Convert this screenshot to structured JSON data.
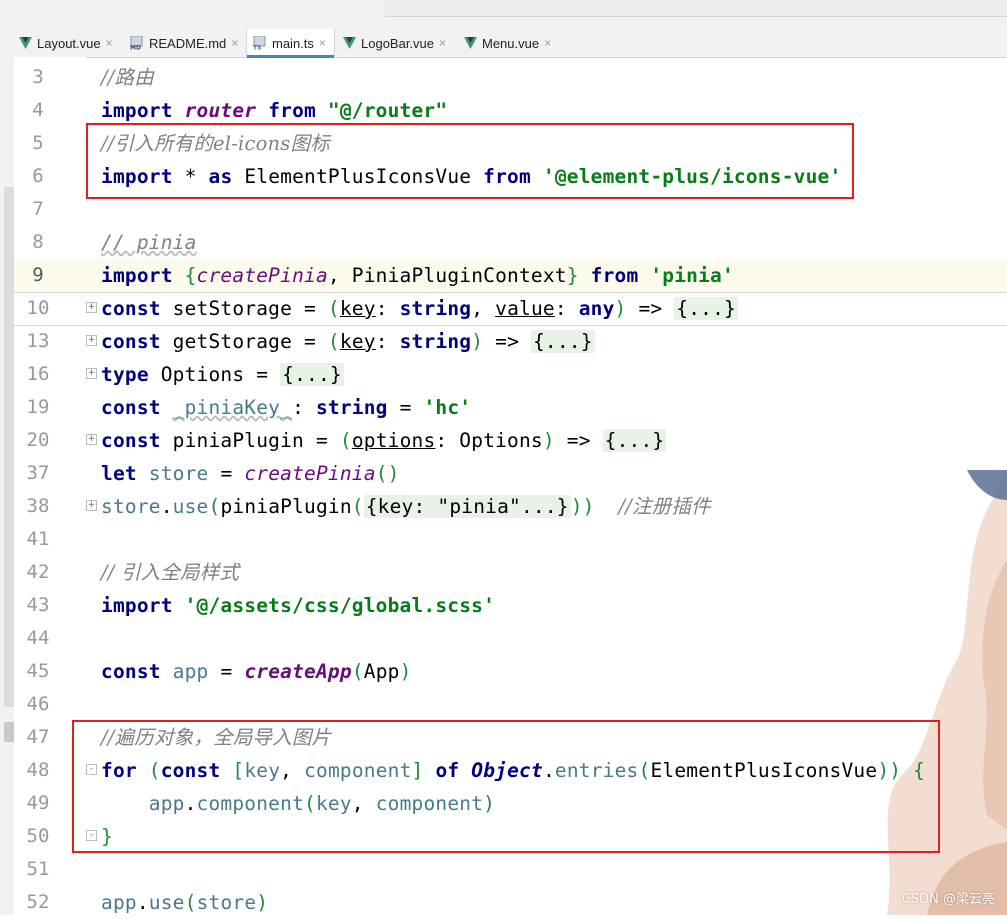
{
  "tabs": [
    {
      "label": "Layout.vue",
      "icon": "vue-file-icon",
      "active": false
    },
    {
      "label": "README.md",
      "icon": "markdown-file-icon",
      "active": false
    },
    {
      "label": "main.ts",
      "icon": "typescript-file-icon",
      "active": true
    },
    {
      "label": "LogoBar.vue",
      "icon": "vue-file-icon",
      "active": false
    },
    {
      "label": "Menu.vue",
      "icon": "vue-file-icon",
      "active": false
    }
  ],
  "icons": {
    "md_badge": "MD",
    "ts_badge": "TS",
    "close_glyph": "×",
    "fold_plus": "+",
    "fold_minus": "-"
  },
  "line_numbers": [
    "3",
    "4",
    "5",
    "6",
    "7",
    "8",
    "9",
    "10",
    "13",
    "16",
    "19",
    "20",
    "37",
    "38",
    "41",
    "42",
    "43",
    "44",
    "45",
    "46",
    "47",
    "48",
    "49",
    "50",
    "51",
    "52"
  ],
  "code": {
    "l3": {
      "comment": "//路由"
    },
    "l4": {
      "kw": "import",
      "fn": "router",
      "kw2": "from",
      "str": "\"@/router\""
    },
    "l5": {
      "comment": "//引入所有的el-icons图标"
    },
    "l6": {
      "kw": "import",
      "op": "*",
      "kw2": "as",
      "id": "ElementPlusIconsVue",
      "kw3": "from",
      "str": "'@element-plus/icons-vue'"
    },
    "l8": {
      "comment": "// pinia"
    },
    "l9": {
      "kw": "import",
      "open": "{",
      "fn": "createPinia",
      "comma": ",",
      "id": "PiniaPluginContext",
      "close": "}",
      "kw2": "from",
      "str": "'pinia'"
    },
    "l10": {
      "kw": "const",
      "id": "setStorage",
      "eq": "=",
      "p1": "key",
      "t1": "string",
      "p2": "value",
      "t2": "any",
      "arrow": "=>",
      "fold": "{...}"
    },
    "l13": {
      "kw": "const",
      "id": "getStorage",
      "eq": "=",
      "p1": "key",
      "t1": "string",
      "arrow": "=>",
      "fold": "{...}"
    },
    "l16": {
      "kw": "type",
      "id": "Options",
      "eq": "=",
      "fold": "{...}"
    },
    "l19": {
      "kw": "const",
      "id": "_piniaKey_",
      "colon": ":",
      "t1": "string",
      "eq": "=",
      "str": "'hc'"
    },
    "l20": {
      "kw": "const",
      "id": "piniaPlugin",
      "eq": "=",
      "p1": "options",
      "t1": "Options",
      "arrow": "=>",
      "fold": "{...}"
    },
    "l37": {
      "kw": "let",
      "var": "store",
      "eq": "=",
      "fn": "createPinia",
      "parens": "()"
    },
    "l38": {
      "var": "store",
      "dot": ".",
      "method": "use",
      "open": "(",
      "id": "piniaPlugin",
      "fold": "{key: \"pinia\"...}",
      "close": "))",
      "comment": "//注册插件"
    },
    "l42": {
      "comment": "// 引入全局样式"
    },
    "l43": {
      "kw": "import",
      "str": "'@/assets/css/global.scss'"
    },
    "l45": {
      "kw": "const",
      "var": "app",
      "eq": "=",
      "fn": "createApp",
      "open": "(",
      "id": "App",
      "close": ")"
    },
    "l47": {
      "comment": "//遍历对象，全局导入图片"
    },
    "l48": {
      "kw": "for",
      "open": "(",
      "kw2": "const",
      "lb": "[",
      "v1": "key",
      "comma": ",",
      "v2": "component",
      "rb": "]",
      "kw3": "of",
      "obj": "Object",
      "dot": ".",
      "method": "entries",
      "id": "ElementPlusIconsVue",
      "close": ")) {"
    },
    "l49": {
      "var": "app",
      "dot": ".",
      "method": "component",
      "open": "(",
      "v1": "key",
      "comma": ",",
      "v2": "component",
      "close": ")"
    },
    "l50": {
      "brace": "}"
    },
    "l52": {
      "var": "app",
      "dot": ".",
      "method": "use",
      "open": "(",
      "v1": "store",
      "close": ")"
    }
  },
  "watermark": "CSDN @梁云亮",
  "colors": {
    "highlight_box": "#e02020",
    "tab_underline": "#4083c9",
    "vue_icon": "#3f9a65",
    "ts_icon": "#3b6fb6"
  }
}
